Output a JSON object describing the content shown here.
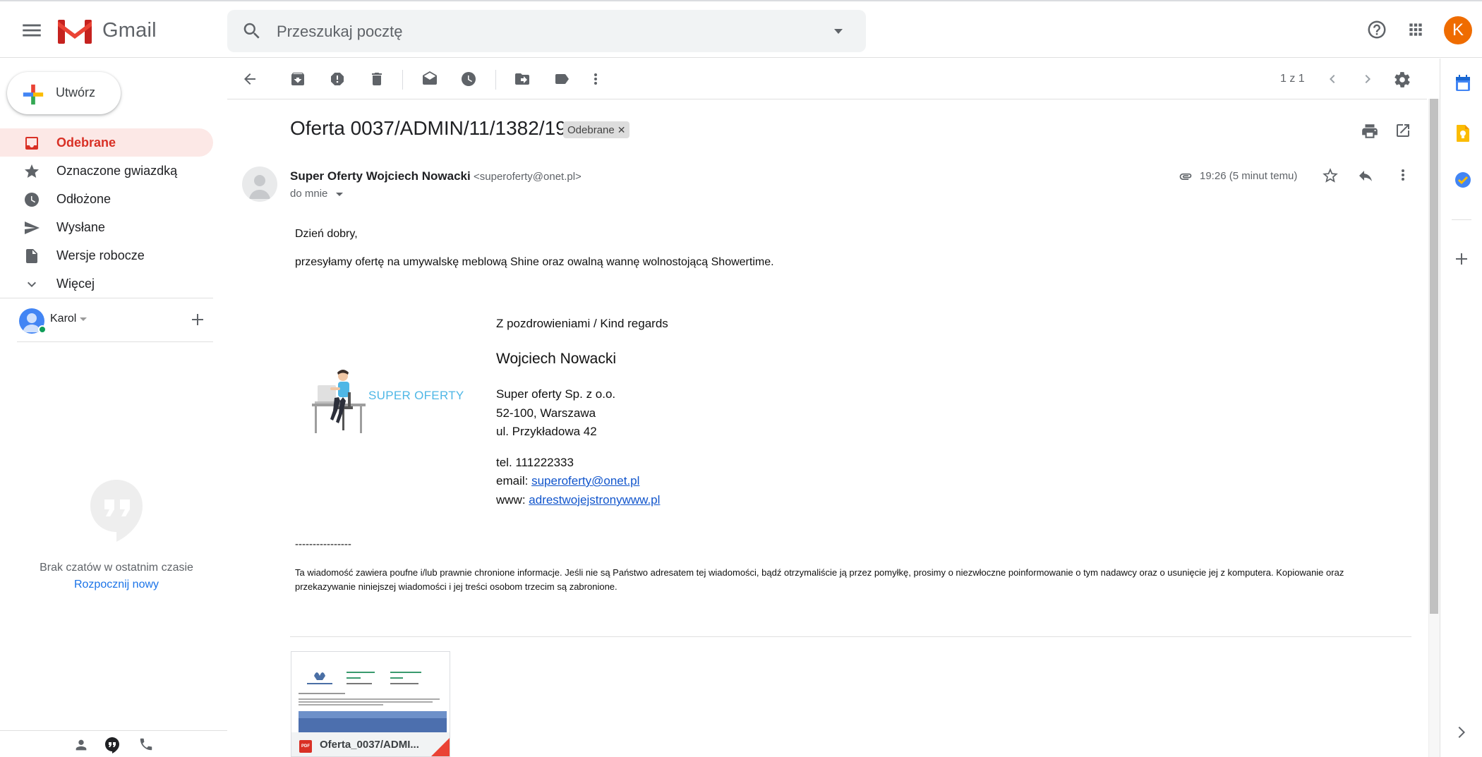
{
  "app": {
    "name": "Gmail",
    "search_placeholder": "Przeszukaj pocztę",
    "avatar_letter": "K",
    "avatar_color": "#ef6c00"
  },
  "nav": {
    "compose_label": "Utwórz",
    "items": [
      {
        "label": "Odebrane",
        "icon": "inbox-icon",
        "active": true
      },
      {
        "label": "Oznaczone gwiazdką",
        "icon": "star-icon"
      },
      {
        "label": "Odłożone",
        "icon": "clock-icon"
      },
      {
        "label": "Wysłane",
        "icon": "send-icon"
      },
      {
        "label": "Wersje robocze",
        "icon": "draft-icon"
      },
      {
        "label": "Więcej",
        "icon": "chevron-down-icon"
      }
    ],
    "user_name": "Karol",
    "no_chats": "Brak czatów w ostatnim czasie",
    "start_new": "Rozpocznij nowy"
  },
  "toolbar": {
    "page_count": "1 z 1"
  },
  "message": {
    "subject": "Oferta 0037/ADMIN/11/1382/19",
    "label": "Odebrane",
    "sender_name": "Super Oferty Wojciech Nowacki",
    "sender_email": "<superoferty@onet.pl>",
    "to": "do mnie",
    "time": "19:26 (5 minut temu)",
    "greeting": "Dzień dobry,",
    "intro": "przesyłamy ofertę na umywalskę meblową Shine oraz owalną wannę wolnostojącą Showertime.",
    "signature": {
      "logo_text": "SUPER OFERTY",
      "regards": "Z pozdrowieniami / Kind regards",
      "name": "Wojciech Nowacki",
      "company": "Super oferty Sp. z o.o.",
      "address1": "52-100, Warszawa",
      "address2": "ul. Przykładowa 42",
      "phone": "tel. 111222333",
      "email_prefix": "email: ",
      "email": "superoferty@onet.pl",
      "www_prefix": "www: ",
      "www": "adrestwojejstronywww.pl"
    },
    "dashes": "----------------",
    "disclaimer": "Ta wiadomość zawiera poufne i/lub prawnie chronione informacje. Jeśli nie są Państwo adresatem tej wiadomości, bądź otrzymaliście ją przez pomyłkę, prosimy o niezwłoczne poinformowanie o tym nadawcy oraz o usunięcie jej z komputera. Kopiowanie oraz przekazywanie niniejszej wiadomości i jej treści osobom trzecim są zabronione.",
    "attachment": {
      "name": "Oferta_0037/ADMI...",
      "type_badge": "PDF"
    }
  }
}
